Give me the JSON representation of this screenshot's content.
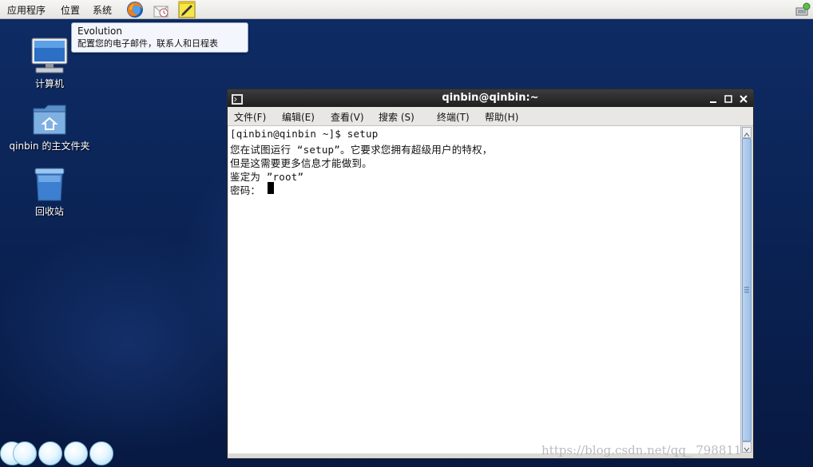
{
  "top_panel": {
    "menus": [
      "应用程序",
      "位置",
      "系统"
    ],
    "launchers": [
      "firefox-icon",
      "evolution-mail-icon",
      "notes-icon"
    ]
  },
  "tooltip": {
    "title": "Evolution",
    "description": "配置您的电子邮件，联系人和日程表"
  },
  "desktop": {
    "icons": [
      {
        "label": "计算机",
        "icon": "computer-icon"
      },
      {
        "label": "qinbin 的主文件夹",
        "icon": "home-folder-icon"
      },
      {
        "label": "回收站",
        "icon": "trash-icon"
      }
    ]
  },
  "terminal": {
    "title": "qinbin@qinbin:~",
    "menus": [
      "文件(F)",
      "编辑(E)",
      "查看(V)",
      "搜索 (S)",
      "终端(T)",
      "帮助(H)"
    ],
    "lines": [
      "[qinbin@qinbin ~]$ setup",
      "您在试图运行 “setup”。它要求您拥有超级用户的特权，",
      "但是这需要更多信息才能做到。",
      "鉴定为 ”root”",
      "密码："
    ]
  },
  "watermark": "https://blog.csdn.net/qq_  798811",
  "colors": {
    "desktop_bg": "#0b2456",
    "titlebar": "#2a2a2a",
    "terminal_bg": "#ffffff",
    "scroll_thumb": "#9dbfe6"
  }
}
